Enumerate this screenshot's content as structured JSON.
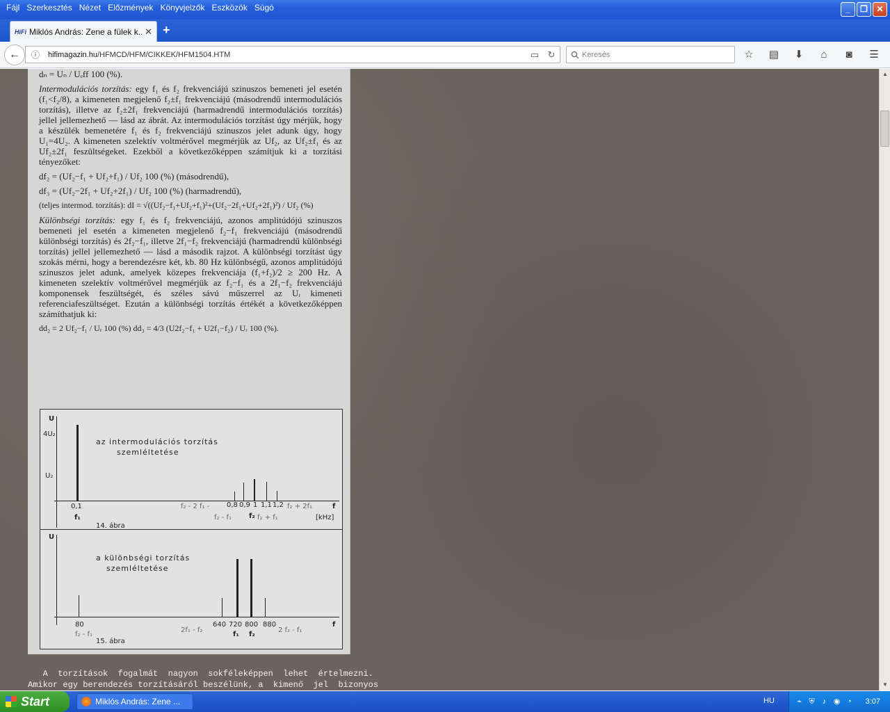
{
  "menu": {
    "items": [
      "Fájl",
      "Szerkesztés",
      "Nézet",
      "Előzmények",
      "Könyvjelzők",
      "Eszközök",
      "Súgó"
    ]
  },
  "tab": {
    "favicon": "HiFi",
    "title": "Miklós András: Zene a fülek k...",
    "close": "✕",
    "new": "+"
  },
  "nav": {
    "url_domain": "hifimagazin.hu",
    "url_path": "/HFMCD/HFM/CIKKEK/HFM1504.HTM",
    "search_placeholder": "Keresés"
  },
  "article": {
    "formula_dn": "dₙ = Uₙ / Uₑff 100 (%).",
    "p1_lead": "Intermodulációs torzítás:",
    "p1": "egy f₁ és f₂ frekvenciájú szinuszos bemeneti jel esetén (f₁<f₂/8), a kimeneten megjelenő f₂±f₁ frekvenciájú (másodrendű intermodulációs torzítás), illetve az f₂±2f₁ frekvenciájú (harmadrendű intermodulációs torzítás) jellel jellemezhető — lásd az ábrát. Az intermodulációs torzítást úgy mérjük, hogy a készülék bemenetére f₁ és f₂ frekvenciájú szinuszos jelet adunk úgy, hogy U₁=4U₂. A kimeneten szelektív voltmérővel megmérjük az Uf₂, az Uf₂±f₁ és az Uf₂±2f₁ feszültségeket. Ezekből a következőképpen számítjuk ki a torzítási tényezőket:",
    "formula_d2": "df₂ = (Uf₂−f₁ + Uf₂+f₁) / Uf₂ 100 (%) (másodrendű),",
    "formula_d3": "df₃ = (Uf₂−2f₁ + Uf₂+2f₁) / Uf₂ 100 (%) (harmadrendű),",
    "formula_dt": "(teljes intermod. torzítás): dI = √((Uf₂−f₁+Uf₂+f₁)²+(Uf₂−2f₁+Uf₂+2f₁)²) / Uf₂ (%)",
    "p2_lead": "Különbségi torzítás:",
    "p2": "egy f₁ és f₂ frekvenciájú, azonos amplitúdójú szinuszos bemeneti jel esetén a kimeneten megjelenő f₂−f₁ frekvenciájú (másodrendű különbségi torzítás) és 2f₂−f₁, illetve 2f₁−f₂ frekvenciájú (harmadrendű különbségi torzítás) jellel jellemezhető — lásd a második rajzot. A különbségi torzítást úgy szokás mérni, hogy a berendezésre két, kb. 80 Hz különbségű, azonos amplitúdójú szinuszos jelet adunk, amelyek közepes frekvenciája (f₁+f₂)/2 ≥ 200 Hz. A kimeneten szelektív voltmérővel megmérjük az f₂−f₁ és a 2f₁−f₂ frekvenciájú komponensek feszültségét, és széles sávú műszerrel az Uᵣ kimeneti referenciafeszültséget. Ezután a különbségi torzítás értékét a következőképpen számíthatjuk ki:",
    "formula_dd": "dd₂ = 2 Uf₂−f₁ / Uᵣ 100 (%)        dd₃ = 4/3 (U2f₂−f₁ + U2f₁−f₂) / Uᵣ 100 (%)."
  },
  "figure14": {
    "y_label": "U",
    "y_tick_high": "4U₂",
    "y_tick_low": "U₂",
    "title_line1": "az intermodulációs torzítás",
    "title_line2": "szemléltetése",
    "tick_01": "0,1",
    "tick_f1": "f₁",
    "tick_f2m2f1": "f₂ - 2 f₁ -",
    "tick_08": "0,8",
    "tick_09": "0,9",
    "tick_1": "1",
    "tick_11": "1,1",
    "tick_12": "1,2",
    "tick_f2p2f1": "f₂ + 2f₁",
    "tick_f2mf1": "f₂ - f₁",
    "tick_f2": "f₂",
    "tick_f2pf1": "f₂ + f₁",
    "x_label": "f",
    "unit": "[kHz]",
    "caption": "14. ábra"
  },
  "figure15": {
    "y_label": "U",
    "title_line1": "a különbségi torzítás",
    "title_line2": "szemléltetése",
    "tick_80": "80",
    "tick_f2mf1": "f₂ - f₁",
    "tick_2f1mf2": "2f₁ - f₂",
    "tick_640": "640",
    "tick_720": "720",
    "tick_800": "800",
    "tick_880": "880",
    "tick_f1": "f₁",
    "tick_f2": "f₂",
    "tick_2f2mf1": "2 f₂ - f₁",
    "x_label": "f",
    "caption": "15. ábra"
  },
  "body_text": {
    "line1": "   A  torzítások  fogalmát  nagyon  sokféleképpen  lehet  értelmezni.",
    "line2": "Amikor egy berendezés torzításáról beszélünk, a  kimenő  jel  bizonyos"
  },
  "taskbar": {
    "start": "Start",
    "item": "Miklós András: Zene ...",
    "lang": "HU",
    "clock": "3:07"
  }
}
